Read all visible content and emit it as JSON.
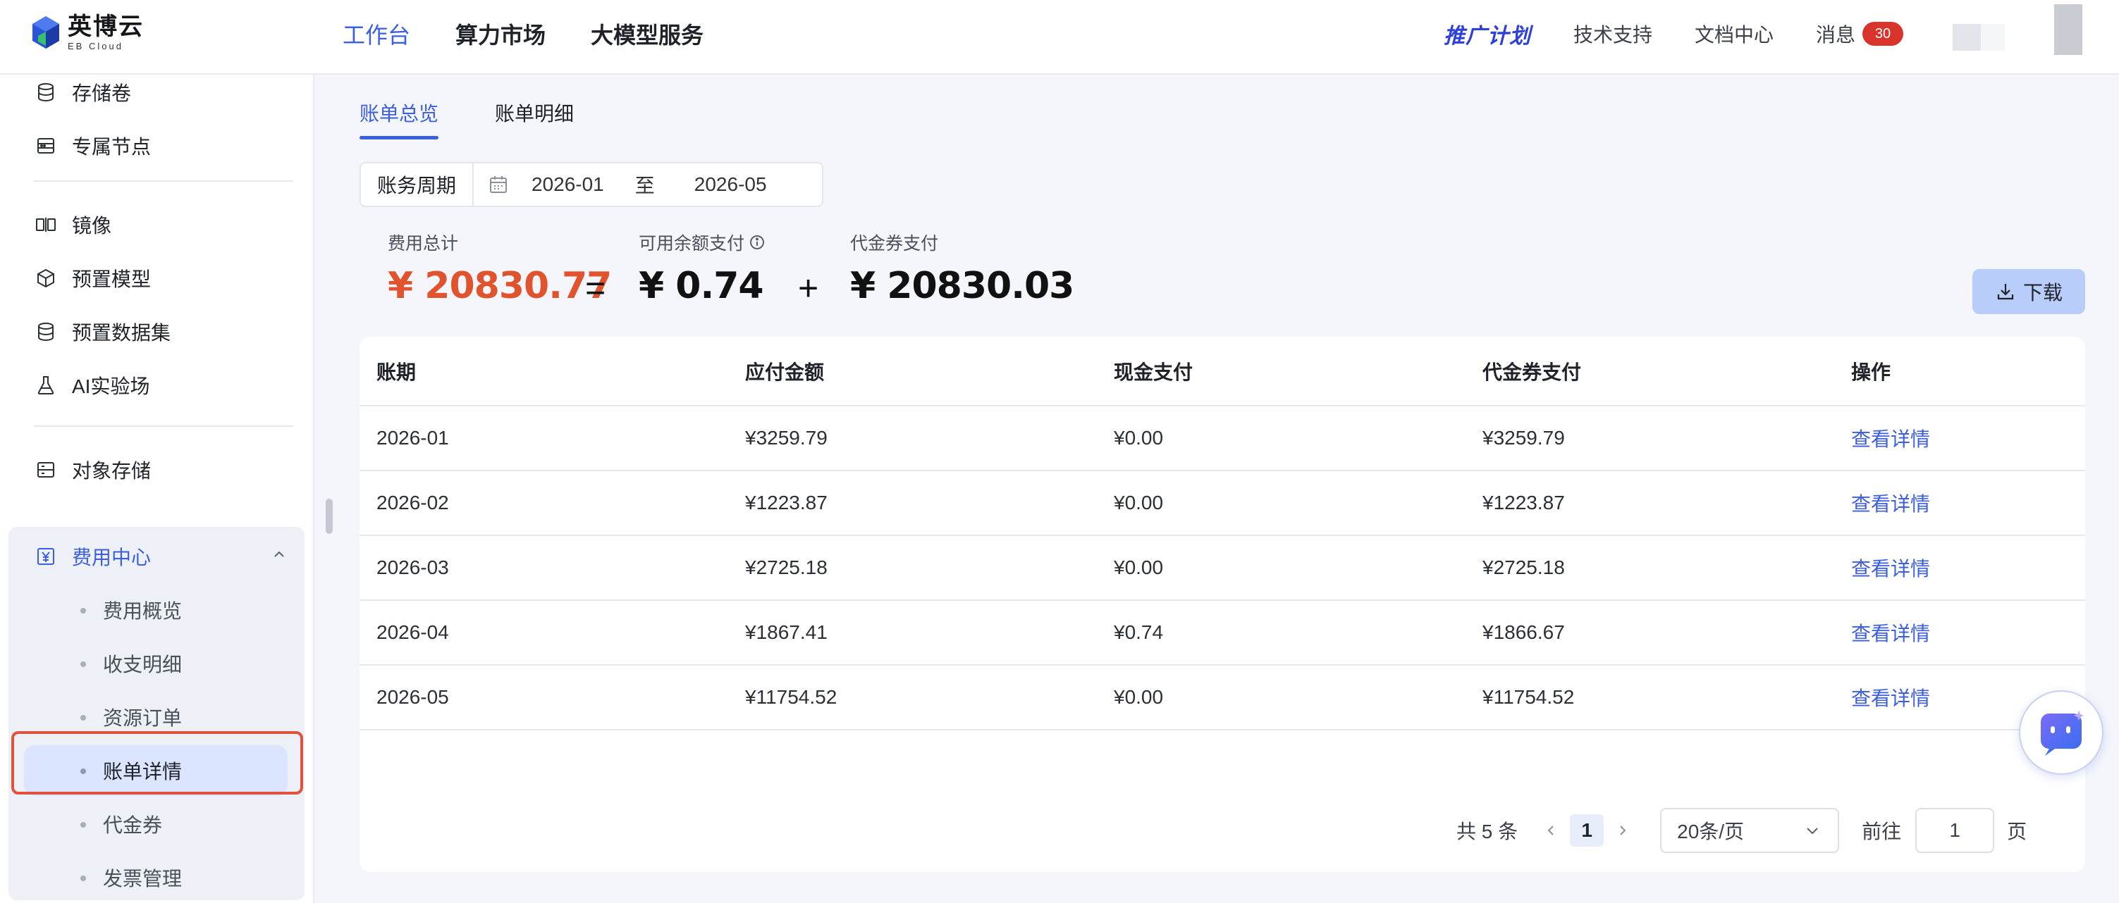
{
  "app": {
    "brand": "英博云",
    "brand_en": "EB Cloud"
  },
  "topnav": {
    "items": [
      "工作台",
      "算力市场",
      "大模型服务"
    ],
    "active": "工作台",
    "promo": "推广计划",
    "tech_support": "技术支持",
    "docs": "文档中心",
    "messages": "消息",
    "message_count": "30"
  },
  "sidebar": {
    "items": [
      {
        "label": "存储卷",
        "icon": "database-icon"
      },
      {
        "label": "专属节点",
        "icon": "server-icon"
      },
      {
        "label": "镜像",
        "icon": "image-icon"
      },
      {
        "label": "预置模型",
        "icon": "cube-icon"
      },
      {
        "label": "预置数据集",
        "icon": "dataset-icon"
      },
      {
        "label": "AI实验场",
        "icon": "flask-icon"
      },
      {
        "label": "对象存储",
        "icon": "storage-icon"
      }
    ],
    "fee_center": {
      "label": "费用中心",
      "icon": "yen-icon",
      "expanded": true,
      "subitems": [
        "费用概览",
        "收支明细",
        "资源订单",
        "账单详情",
        "代金券",
        "发票管理"
      ],
      "active": "账单详情"
    }
  },
  "tabs": [
    "账单总览",
    "账单明细"
  ],
  "active_tab": "账单总览",
  "period": {
    "label": "账务周期",
    "start": "2026-01",
    "separator": "至",
    "end": "2026-05"
  },
  "summary": {
    "total_label": "费用总计",
    "total": "¥ 20830.77",
    "equals": "=",
    "balance_label": "可用余额支付",
    "balance": "¥ 0.74",
    "plus": "+",
    "voucher_label": "代金券支付",
    "voucher": "¥ 20830.03"
  },
  "download_label": "下载",
  "table": {
    "headers": [
      "账期",
      "应付金额",
      "现金支付",
      "代金券支付",
      "操作"
    ],
    "rows": [
      [
        "2026-01",
        "¥3259.79",
        "¥0.00",
        "¥3259.79",
        "查看详情"
      ],
      [
        "2026-02",
        "¥1223.87",
        "¥0.00",
        "¥1223.87",
        "查看详情"
      ],
      [
        "2026-03",
        "¥2725.18",
        "¥0.00",
        "¥2725.18",
        "查看详情"
      ],
      [
        "2026-04",
        "¥1867.41",
        "¥0.74",
        "¥1866.67",
        "查看详情"
      ],
      [
        "2026-05",
        "¥11754.52",
        "¥0.00",
        "¥11754.52",
        "查看详情"
      ]
    ]
  },
  "pagination": {
    "total_text": "共 5 条",
    "current_page": "1",
    "page_size": "20条/页",
    "goto_label": "前往",
    "goto_value": "1",
    "page_unit": "页"
  },
  "colors": {
    "accent": "#3c5ee0",
    "total_amount": "#e0532c",
    "badge": "#d9342b",
    "highlight_border": "#e0533c"
  }
}
